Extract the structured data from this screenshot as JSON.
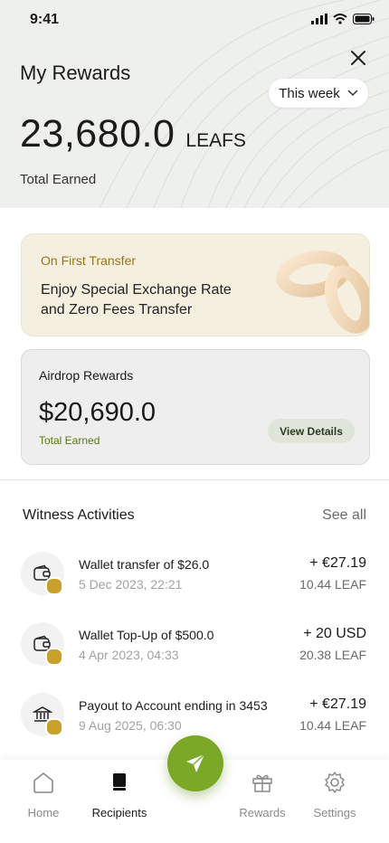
{
  "status": {
    "time": "9:41"
  },
  "header": {
    "title": "My Rewards",
    "period": "This week",
    "total_value": "23,680.0",
    "total_unit": "LEAFS",
    "total_label": "Total Earned"
  },
  "promo": {
    "tag": "On First Transfer",
    "text": "Enjoy Special Exchange Rate and Zero Fees Transfer"
  },
  "airdrop": {
    "label": "Airdrop Rewards",
    "amount": "$20,690.0",
    "sublabel": "Total Earned",
    "button": "View Details"
  },
  "activities": {
    "title": "Witness Activities",
    "see_all": "See all",
    "items": [
      {
        "title": "Wallet transfer of $26.0",
        "date": "5 Dec 2023, 22:21",
        "amount": "+ €27.19",
        "leaf": "10.44 LEAF",
        "icon": "wallet-icon"
      },
      {
        "title": "Wallet Top-Up of $500.0",
        "date": "4 Apr 2023, 04:33",
        "amount": "+ 20 USD",
        "leaf": "20.38 LEAF",
        "icon": "wallet-icon"
      },
      {
        "title": "Payout to Account ending in 3453",
        "date": "9 Aug 2025, 06:30",
        "amount": "+ €27.19",
        "leaf": "10.44 LEAF",
        "icon": "bank-icon"
      }
    ]
  },
  "nav": {
    "home": "Home",
    "recipients": "Recipients",
    "rewards": "Rewards",
    "settings": "Settings"
  },
  "colors": {
    "accent": "#7ba826",
    "gold": "#c8a02a"
  }
}
